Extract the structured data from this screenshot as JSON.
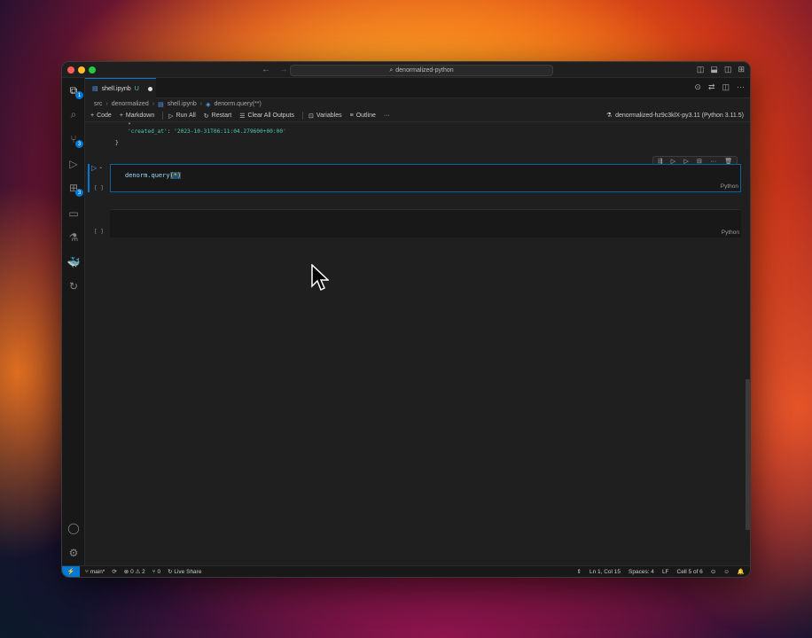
{
  "window": {
    "search_text": "denormalized-python"
  },
  "activity": {
    "explorer_badge": "1",
    "scm_badge": "3",
    "extensions_badge": "3"
  },
  "tab": {
    "name": "shell.ipynb",
    "modified": "U"
  },
  "breadcrumb": [
    "src",
    "denormalized",
    "shell.ipynb",
    "denorm.query(**)"
  ],
  "toolbar": {
    "code": "Code",
    "markdown": "Markdown",
    "run_all": "Run All",
    "restart": "Restart",
    "clear_outputs": "Clear All Outputs",
    "variables": "Variables",
    "outline": "Outline",
    "more": "···",
    "kernel": "denormalized-hz9c3klX-py3.11 (Python 3.11.5)"
  },
  "output": {
    "line1": "\"",
    "line2_key": "'created_at'",
    "line2_value": "'2023-10-31T06:11:04.279600+00:00'",
    "line3": "}"
  },
  "cells": [
    {
      "exec": "[ ]",
      "code_fn": "denorm.query",
      "code_arg": "(*)",
      "lang": "Python"
    },
    {
      "exec": "[ ]",
      "lang": "Python"
    }
  ],
  "status": {
    "branch": "main*",
    "errors": "0",
    "warnings": "2",
    "ports": "0",
    "live_share": "Live Share",
    "position": "Ln 1, Col 15",
    "spaces": "Spaces: 4",
    "eol": "LF",
    "cell": "Cell 5 of 6"
  },
  "colors": {
    "accent": "#0078d4",
    "editor_bg": "#1f1f1f",
    "string": "#4ec9b0"
  }
}
